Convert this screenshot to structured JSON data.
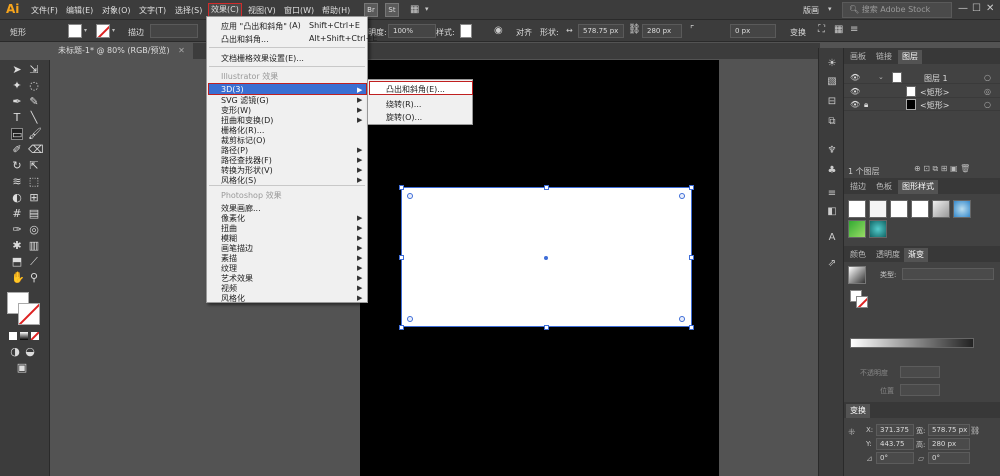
{
  "app": {
    "logo": "Ai"
  },
  "menubar": {
    "items": [
      "文件(F)",
      "编辑(E)",
      "对象(O)",
      "文字(T)",
      "选择(S)",
      "效果(C)",
      "视图(V)",
      "窗口(W)",
      "帮助(H)"
    ],
    "badges": [
      "Br",
      "St"
    ],
    "workspace": "版画",
    "search_placeholder": "搜索 Adobe Stock"
  },
  "options_bar": {
    "shape_label": "矩形",
    "stroke_label": "描边",
    "opacity_label": "明度:",
    "opacity_value": "100%",
    "style_label": "样式:",
    "align_label": "对齐",
    "shape_prop_label": "形状:",
    "width_value": "578.75 px",
    "height_value": "280 px",
    "corner_value": "0 px",
    "transform_label": "变换"
  },
  "document": {
    "tab_title": "未标题-1* @ 80% (RGB/预览)"
  },
  "effect_menu": {
    "apply_last": "应用 \"凸出和斜角\"",
    "apply_last_sc": "Shift+Ctrl+E",
    "last_effect": "凸出和斜角...",
    "last_effect_sc": "Alt+Shift+Ctrl+E",
    "raster_settings": "文档栅格效果设置(E)...",
    "illustrator_header": "Illustrator 效果",
    "illustrator_items": [
      "3D(3)",
      "SVG 滤镜(G)",
      "变形(W)",
      "扭曲和变换(D)",
      "栅格化(R)...",
      "裁剪标记(O)",
      "路径(P)",
      "路径查找器(F)",
      "转换为形状(V)",
      "风格化(S)"
    ],
    "illustrator_has_sub": [
      true,
      true,
      true,
      true,
      false,
      false,
      true,
      true,
      true,
      true
    ],
    "photoshop_header": "Photoshop 效果",
    "photoshop_items": [
      "效果画廊...",
      "像素化",
      "扭曲",
      "模糊",
      "画笔描边",
      "素描",
      "纹理",
      "艺术效果",
      "视频",
      "风格化"
    ],
    "photoshop_has_sub": [
      false,
      true,
      true,
      true,
      true,
      true,
      true,
      true,
      true,
      true
    ]
  },
  "submenu_3d": {
    "items": [
      "凸出和斜角(E)...",
      "绕转(R)...",
      "旋转(O)..."
    ]
  },
  "layers_panel": {
    "tabs": [
      "画板",
      "链接",
      "图层"
    ],
    "layer_name": "图层 1",
    "sublayers": [
      "<矩形>",
      "<矩形>"
    ],
    "footer": "1 个图层"
  },
  "graphic_styles_panel": {
    "tabs": [
      "描边",
      "色板",
      "图形样式"
    ]
  },
  "gradient_panel": {
    "tabs": [
      "颜色",
      "透明度",
      "渐变"
    ],
    "type_label": "类型:",
    "opacity_label": "不透明度",
    "position_label": "位置"
  },
  "transform_panel": {
    "title": "变换",
    "x_label": "X:",
    "x_value": "371.375 p",
    "w_label": "宽:",
    "w_value": "578.75 px",
    "y_label": "Y:",
    "y_value": "443.75 px",
    "h_label": "高:",
    "h_value": "280 px",
    "angle_value": "0°",
    "shear_value": "0°"
  },
  "colors": {
    "highlight_blue": "#3a6fd2",
    "highlight_red": "#c02020",
    "selection_blue": "#3f6ed8",
    "logo_orange": "#f7a51c"
  }
}
